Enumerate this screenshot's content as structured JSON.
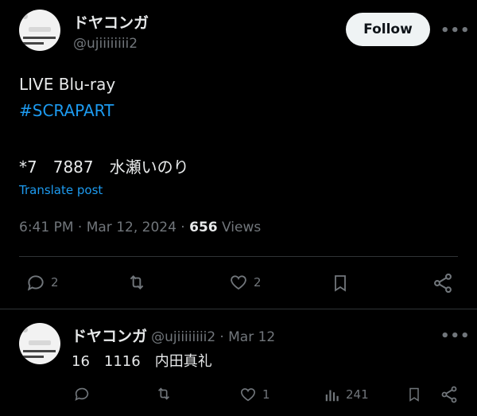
{
  "main_tweet": {
    "author_name": "ドヤコンガ",
    "author_handle": "@ujiiiiiiii2",
    "follow_label": "Follow",
    "more_label": "•••",
    "lines": [
      "LIVE Blu-ray",
      "#SCRAPART",
      "*7　7887　水瀬いのり"
    ],
    "translate_label": "Translate post",
    "timestamp": "6:41 PM · Mar 12, 2024 · ",
    "views_count": "656",
    "views_label": " Views",
    "actions": {
      "reply_count": "2",
      "like_count": "2"
    }
  },
  "reply_tweet": {
    "author_name": "ドヤコンガ",
    "author_handle": "@ujiiiiiiii2",
    "date": "· Mar 12",
    "more_label": "•••",
    "text": "16　1116　内田真礼",
    "actions": {
      "like_count": "1",
      "views_count": "241"
    }
  },
  "icons": [
    "reply-icon",
    "retweet-icon",
    "like-icon",
    "bookmark-icon",
    "share-icon",
    "views-icon",
    "more-icon"
  ],
  "colors": {
    "background": "#000000",
    "link": "#1d9bf0",
    "muted": "#71767b",
    "text": "#e7e9ea"
  }
}
